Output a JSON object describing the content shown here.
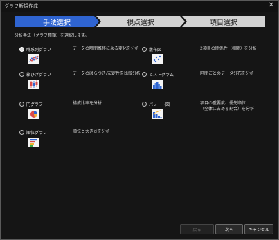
{
  "window": {
    "title": "グラフ新規作成",
    "close_glyph": "✕"
  },
  "steps": [
    {
      "label": "手法選択",
      "active": true
    },
    {
      "label": "視点選択",
      "active": false
    },
    {
      "label": "項目選択",
      "active": false
    }
  ],
  "instruction": "分析手法（グラフ種類）を選択します。",
  "options": [
    {
      "label": "時系列グラフ",
      "selected": true,
      "description": "データの時間推移による変化を分析",
      "icon": "line-chart-icon"
    },
    {
      "label": "散布図",
      "selected": false,
      "description": "2項目の関係性（相関）を分析",
      "icon": "scatter-chart-icon"
    },
    {
      "label": "箱ひげグラフ",
      "selected": false,
      "description": "データのばらつき/安定性を比較分析",
      "icon": "box-plot-icon"
    },
    {
      "label": "ヒストグラム",
      "selected": false,
      "description": "区間ごとのデータ分布を分析",
      "icon": "histogram-icon"
    },
    {
      "label": "円グラフ",
      "selected": false,
      "description": "構成比率を分析",
      "icon": "pie-chart-icon"
    },
    {
      "label": "パレート図",
      "selected": false,
      "description_line1": "項目の重要度、優先順位",
      "description_line2": "（全体に占める割合）を分析",
      "icon": "pareto-chart-icon"
    },
    {
      "label": "順位グラフ",
      "selected": false,
      "description": "順位と大きさを分析",
      "icon": "ranking-chart-icon"
    }
  ],
  "buttons": {
    "back": "戻る",
    "next": "次へ",
    "cancel": "キャンセル"
  },
  "colors": {
    "accent": "#2f64d1",
    "inactive_step": "#d2d2d2",
    "background": "#151515"
  }
}
